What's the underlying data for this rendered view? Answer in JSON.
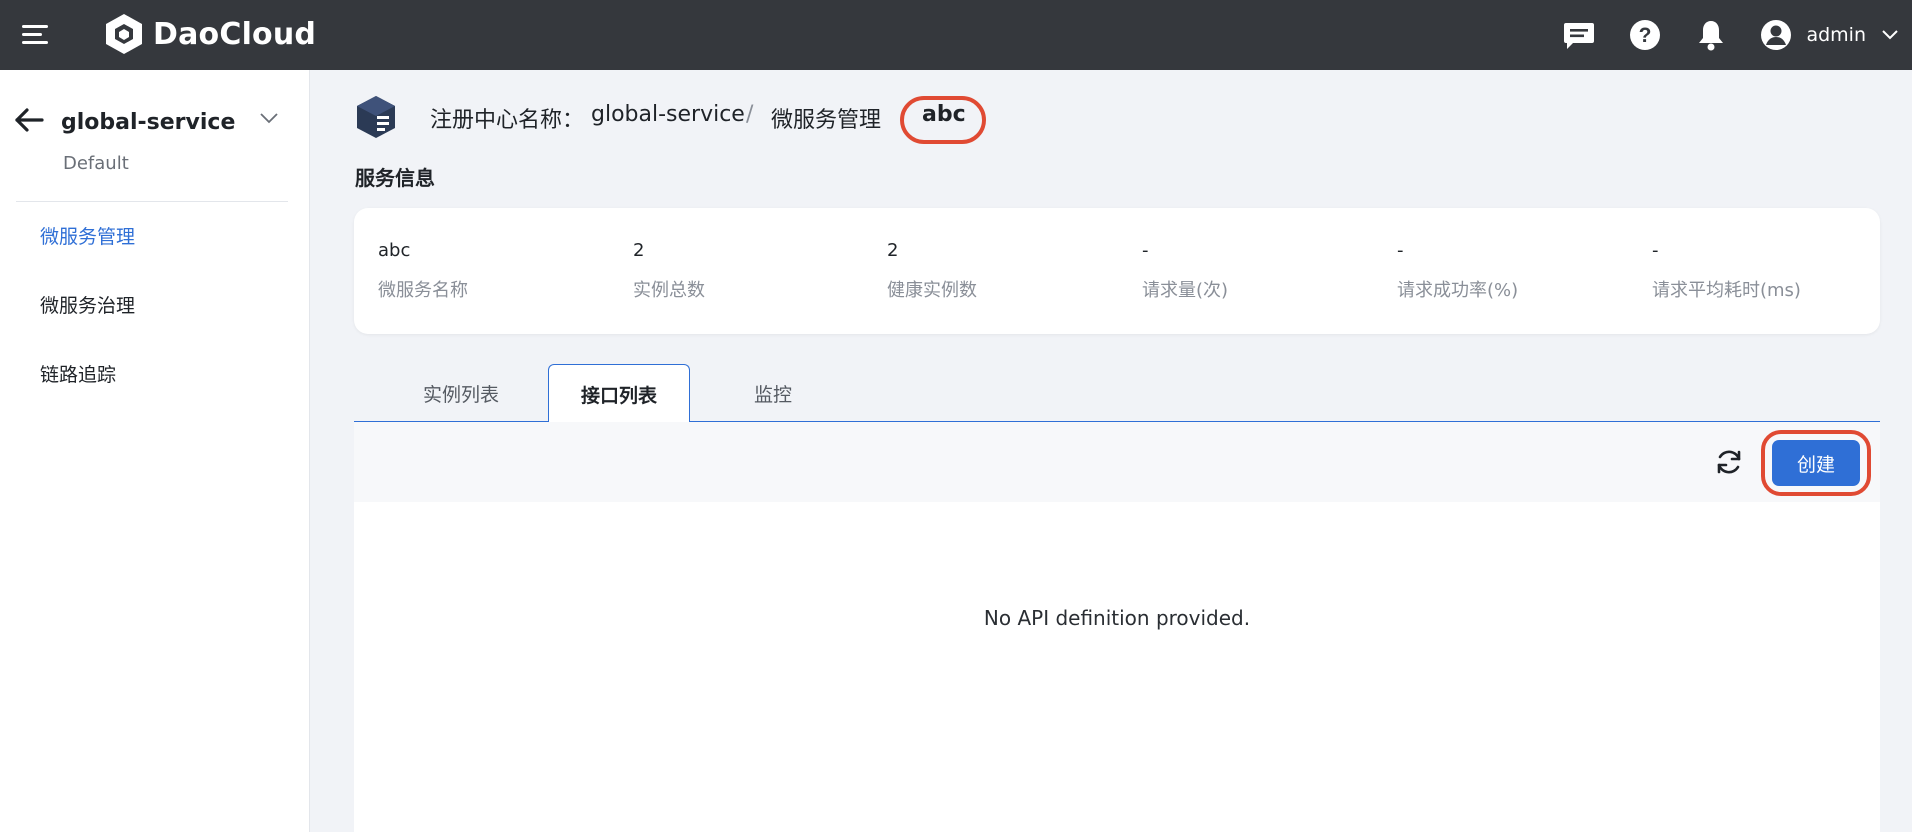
{
  "header": {
    "brand": "DaoCloud",
    "user": "admin",
    "icons": [
      "menu-icon",
      "message-icon",
      "help-icon",
      "bell-icon",
      "user-avatar-icon",
      "chevron-down-icon"
    ]
  },
  "sidebar": {
    "title": "global-service",
    "subtitle": "Default",
    "items": [
      {
        "label": "微服务管理",
        "active": true
      },
      {
        "label": "微服务治理",
        "active": false
      },
      {
        "label": "链路追踪",
        "active": false
      }
    ]
  },
  "breadcrumb": {
    "label": "注册中心名称：",
    "registry": "global-service",
    "separator": "/",
    "section": "微服务管理",
    "current": "abc"
  },
  "service_info": {
    "title": "服务信息",
    "fields": [
      {
        "value": "abc",
        "label": "微服务名称"
      },
      {
        "value": "2",
        "label": "实例总数"
      },
      {
        "value": "2",
        "label": "健康实例数"
      },
      {
        "value": "-",
        "label": "请求量(次)"
      },
      {
        "value": "-",
        "label": "请求成功率(%)"
      },
      {
        "value": "-",
        "label": "请求平均耗时(ms)"
      }
    ]
  },
  "tabs": [
    {
      "label": "实例列表",
      "active": false
    },
    {
      "label": "接口列表",
      "active": true
    },
    {
      "label": "监控",
      "active": false
    }
  ],
  "toolbar": {
    "create_label": "创建"
  },
  "empty_state": "No API definition provided.",
  "colors": {
    "topbar": "#35383d",
    "accent": "#2f6fd6",
    "highlight": "#e04a33"
  }
}
